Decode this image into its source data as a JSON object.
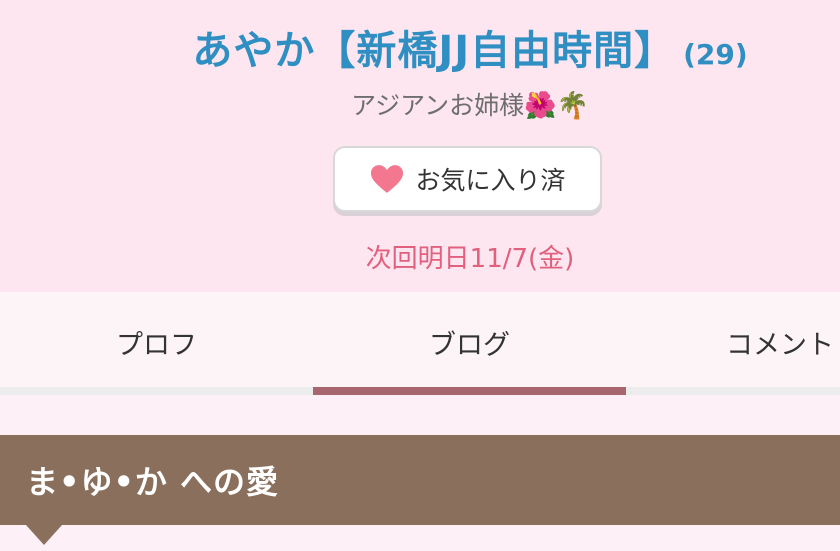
{
  "profile": {
    "name": "あやか【新橋JJ自由時間】",
    "age": "(29)",
    "catchcopy": "アジアンお姉様",
    "catchcopy_emoji": "🌺🌴",
    "favorite_button_label": "お気に入り済",
    "favorite_icon": "heart-icon",
    "next_shift": "次回明日11/7(金)"
  },
  "tabs": [
    {
      "label": "プロフ",
      "active": false
    },
    {
      "label": "ブログ",
      "active": true
    },
    {
      "label": "コメント",
      "active": false
    }
  ],
  "section": {
    "title": "ま•ゆ•か への愛"
  },
  "colors": {
    "header_bg": "#fde6ef",
    "name": "#2f8fc3",
    "next_shift": "#e0607e",
    "heart": "#f2778f",
    "tab_indicator": "#a8676f",
    "section_bg": "#8a6f5c"
  }
}
